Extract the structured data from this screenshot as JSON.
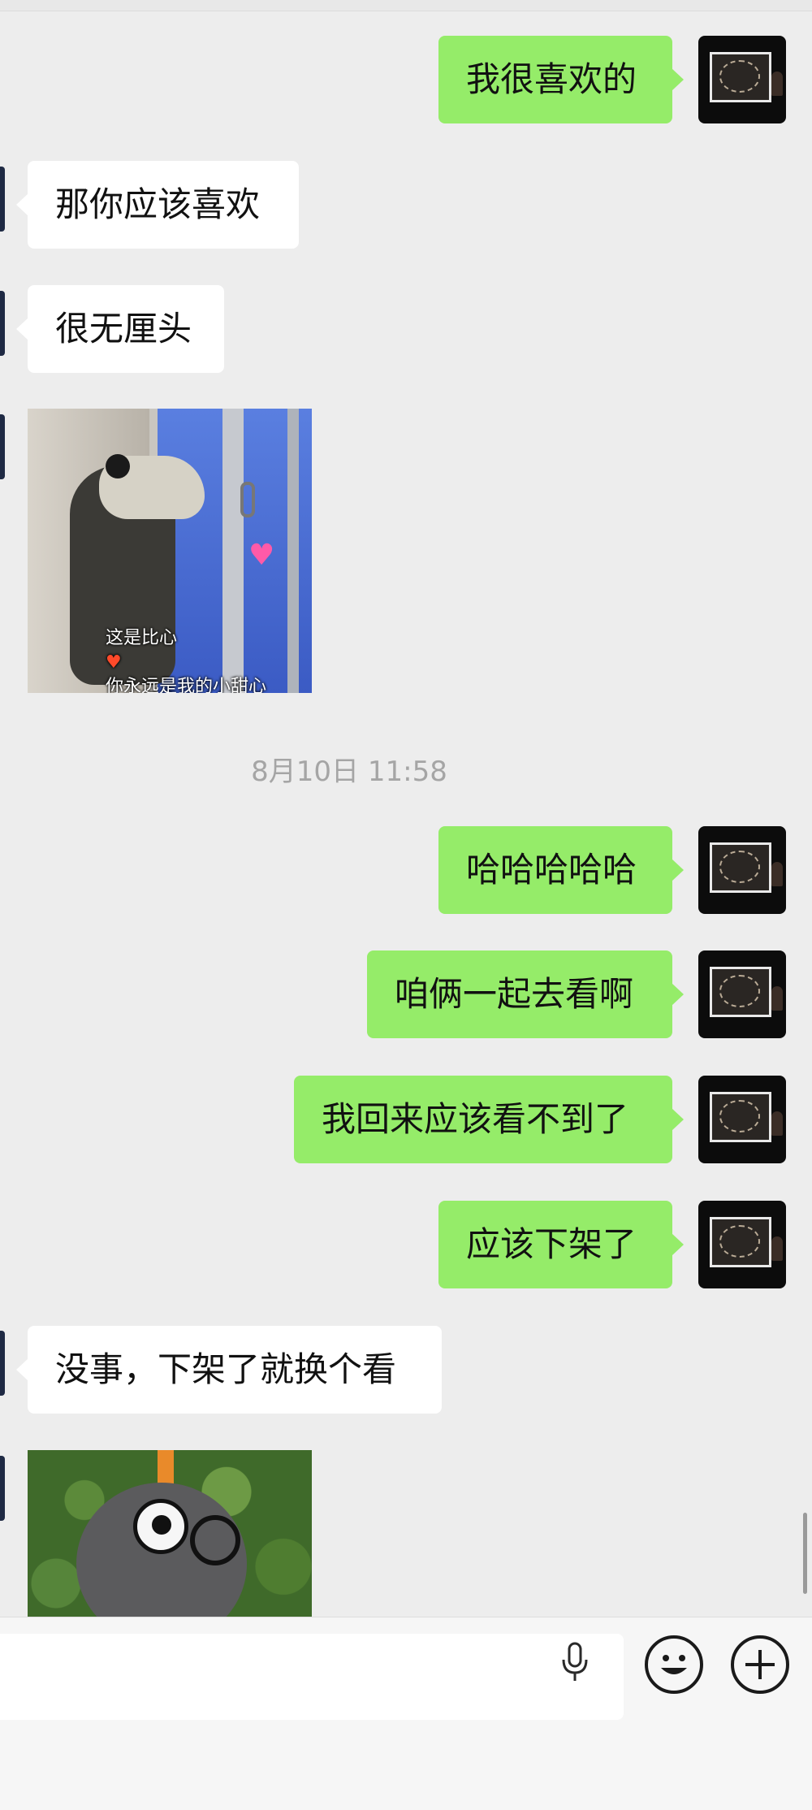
{
  "messages": [
    {
      "side": "me",
      "text": "我很喜欢的"
    },
    {
      "side": "them",
      "text": "那你应该喜欢"
    },
    {
      "side": "them",
      "text": "很无厘头"
    },
    {
      "side": "them",
      "type": "sticker",
      "caption_line1": "这是比心",
      "caption_line2": "你永远是我的小甜心"
    },
    {
      "type": "timestamp",
      "text": "8月10日 11:58"
    },
    {
      "side": "me",
      "text": "哈哈哈哈哈"
    },
    {
      "side": "me",
      "text": "咱俩一起去看啊"
    },
    {
      "side": "me",
      "text": "我回来应该看不到了"
    },
    {
      "side": "me",
      "text": "应该下架了"
    },
    {
      "side": "them",
      "text": "没事，下架了就换个看"
    },
    {
      "side": "them",
      "type": "sticker"
    }
  ],
  "input": {
    "value": "",
    "icons": [
      "microphone-icon",
      "emoji-icon",
      "plus-icon"
    ]
  },
  "colors": {
    "background": "#ededed",
    "my_bubble": "#95ec69",
    "their_bubble": "#ffffff",
    "timestamp_text": "#a5a5a5"
  }
}
